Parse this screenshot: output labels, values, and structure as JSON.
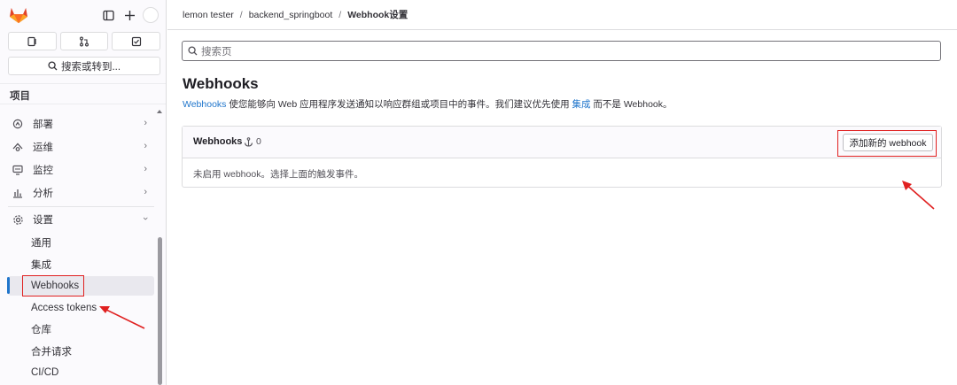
{
  "sidebar": {
    "search_label": "搜索或转到...",
    "section_title": "项目",
    "nav": [
      {
        "label": "部署",
        "icon": "deploy-icon"
      },
      {
        "label": "运维",
        "icon": "operate-icon"
      },
      {
        "label": "监控",
        "icon": "monitor-icon"
      },
      {
        "label": "分析",
        "icon": "analytics-icon"
      }
    ],
    "settings": {
      "label": "设置",
      "icon": "gear-icon"
    },
    "settings_items": [
      "通用",
      "集成",
      "Webhooks",
      "Access tokens",
      "仓库",
      "合并请求",
      "CI/CD"
    ],
    "active_item": "Webhooks"
  },
  "breadcrumb": {
    "items": [
      "lemon tester",
      "backend_springboot",
      "Webhook设置"
    ]
  },
  "search_page": {
    "placeholder": "搜索页"
  },
  "page": {
    "title": "Webhooks",
    "desc_link1": "Webhooks",
    "desc_text1": " 使您能够向 Web 应用程序发送通知以响应群组或项目中的事件。我们建议优先使用 ",
    "desc_link2": "集成",
    "desc_text2": " 而不是 Webhook。"
  },
  "card": {
    "title": "Webhooks",
    "count": "0",
    "add_button": "添加新的 webhook",
    "empty_text": "未启用 webhook。选择上面的触发事件。"
  },
  "colors": {
    "accent": "#1f75cb",
    "highlight": "#e02020",
    "logo": "#e24329"
  }
}
